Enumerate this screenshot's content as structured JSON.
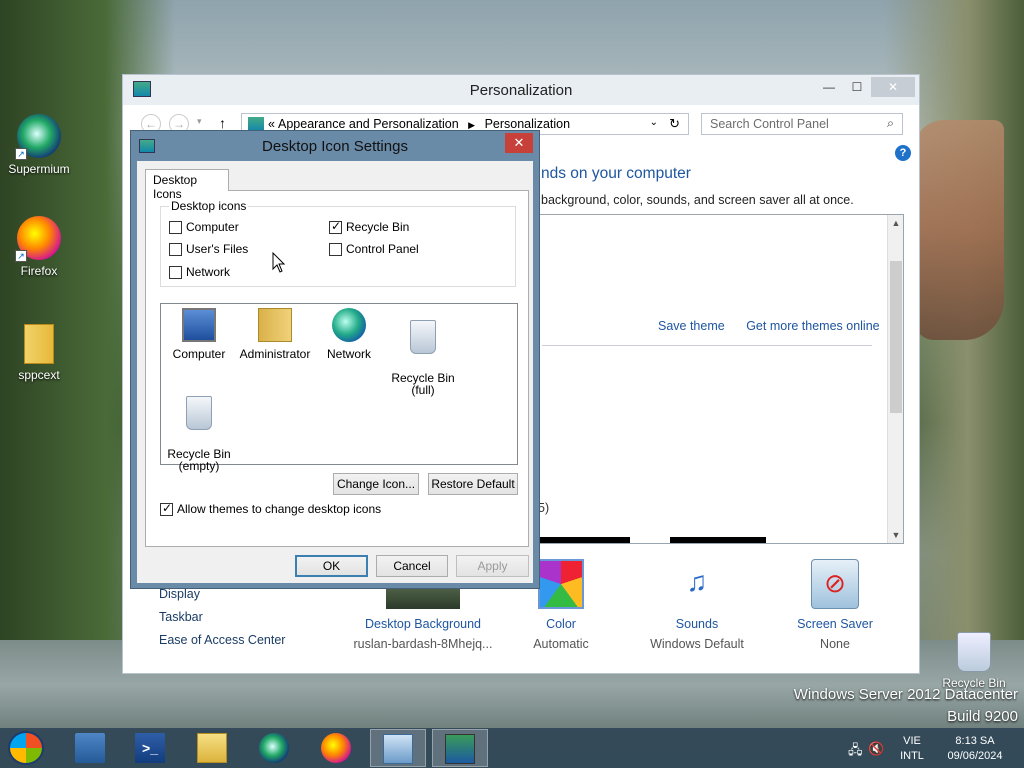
{
  "desktop": {
    "icons": [
      {
        "label": "Supermium"
      },
      {
        "label": "Firefox"
      },
      {
        "label": "sppcext"
      },
      {
        "label": "Recycle Bin"
      }
    ],
    "server_line1": "Windows Server 2012 Datacenter",
    "server_line2": "Build 9200"
  },
  "personalization": {
    "title": "Personalization",
    "breadcrumb_prefix": "«",
    "breadcrumb": [
      "Appearance and Personalization",
      "Personalization"
    ],
    "search_placeholder": "Search Control Panel",
    "heading": "nds on your computer",
    "subtext": "background, color, sounds, and screen saver all at once.",
    "save_theme": "Save theme",
    "get_more_themes": "Get more themes online",
    "theme_count_fragment": "5)",
    "see_also": [
      "Display",
      "Taskbar",
      "Ease of Access Center"
    ],
    "bottom_items": [
      {
        "name": "Desktop Background",
        "value": "ruslan-bardash-8Mhejq..."
      },
      {
        "name": "Color",
        "value": "Automatic"
      },
      {
        "name": "Sounds",
        "value": "Windows Default"
      },
      {
        "name": "Screen Saver",
        "value": "None"
      }
    ]
  },
  "dialog": {
    "title": "Desktop Icon Settings",
    "close": "✕",
    "tab": "Desktop Icons",
    "group_label": "Desktop icons",
    "checkboxes": [
      {
        "label": "Computer",
        "checked": false
      },
      {
        "label": "Recycle Bin",
        "checked": true
      },
      {
        "label": "User's Files",
        "checked": false
      },
      {
        "label": "Control Panel",
        "checked": false
      },
      {
        "label": "Network",
        "checked": false
      }
    ],
    "list_items": [
      {
        "label": "Computer"
      },
      {
        "label": "Administrator"
      },
      {
        "label": "Network"
      },
      {
        "label": "Recycle Bin\n(full)"
      },
      {
        "label": "Recycle Bin\n(empty)"
      }
    ],
    "change_icon": "Change Icon...",
    "restore_default": "Restore Default",
    "allow_themes": "Allow themes to change desktop icons",
    "allow_themes_checked": true,
    "ok": "OK",
    "cancel": "Cancel",
    "apply": "Apply"
  },
  "taskbar": {
    "ps_glyph": ">_",
    "language_line1": "VIE",
    "language_line2": "INTL",
    "time": "8:13 SA",
    "date": "09/06/2024"
  }
}
